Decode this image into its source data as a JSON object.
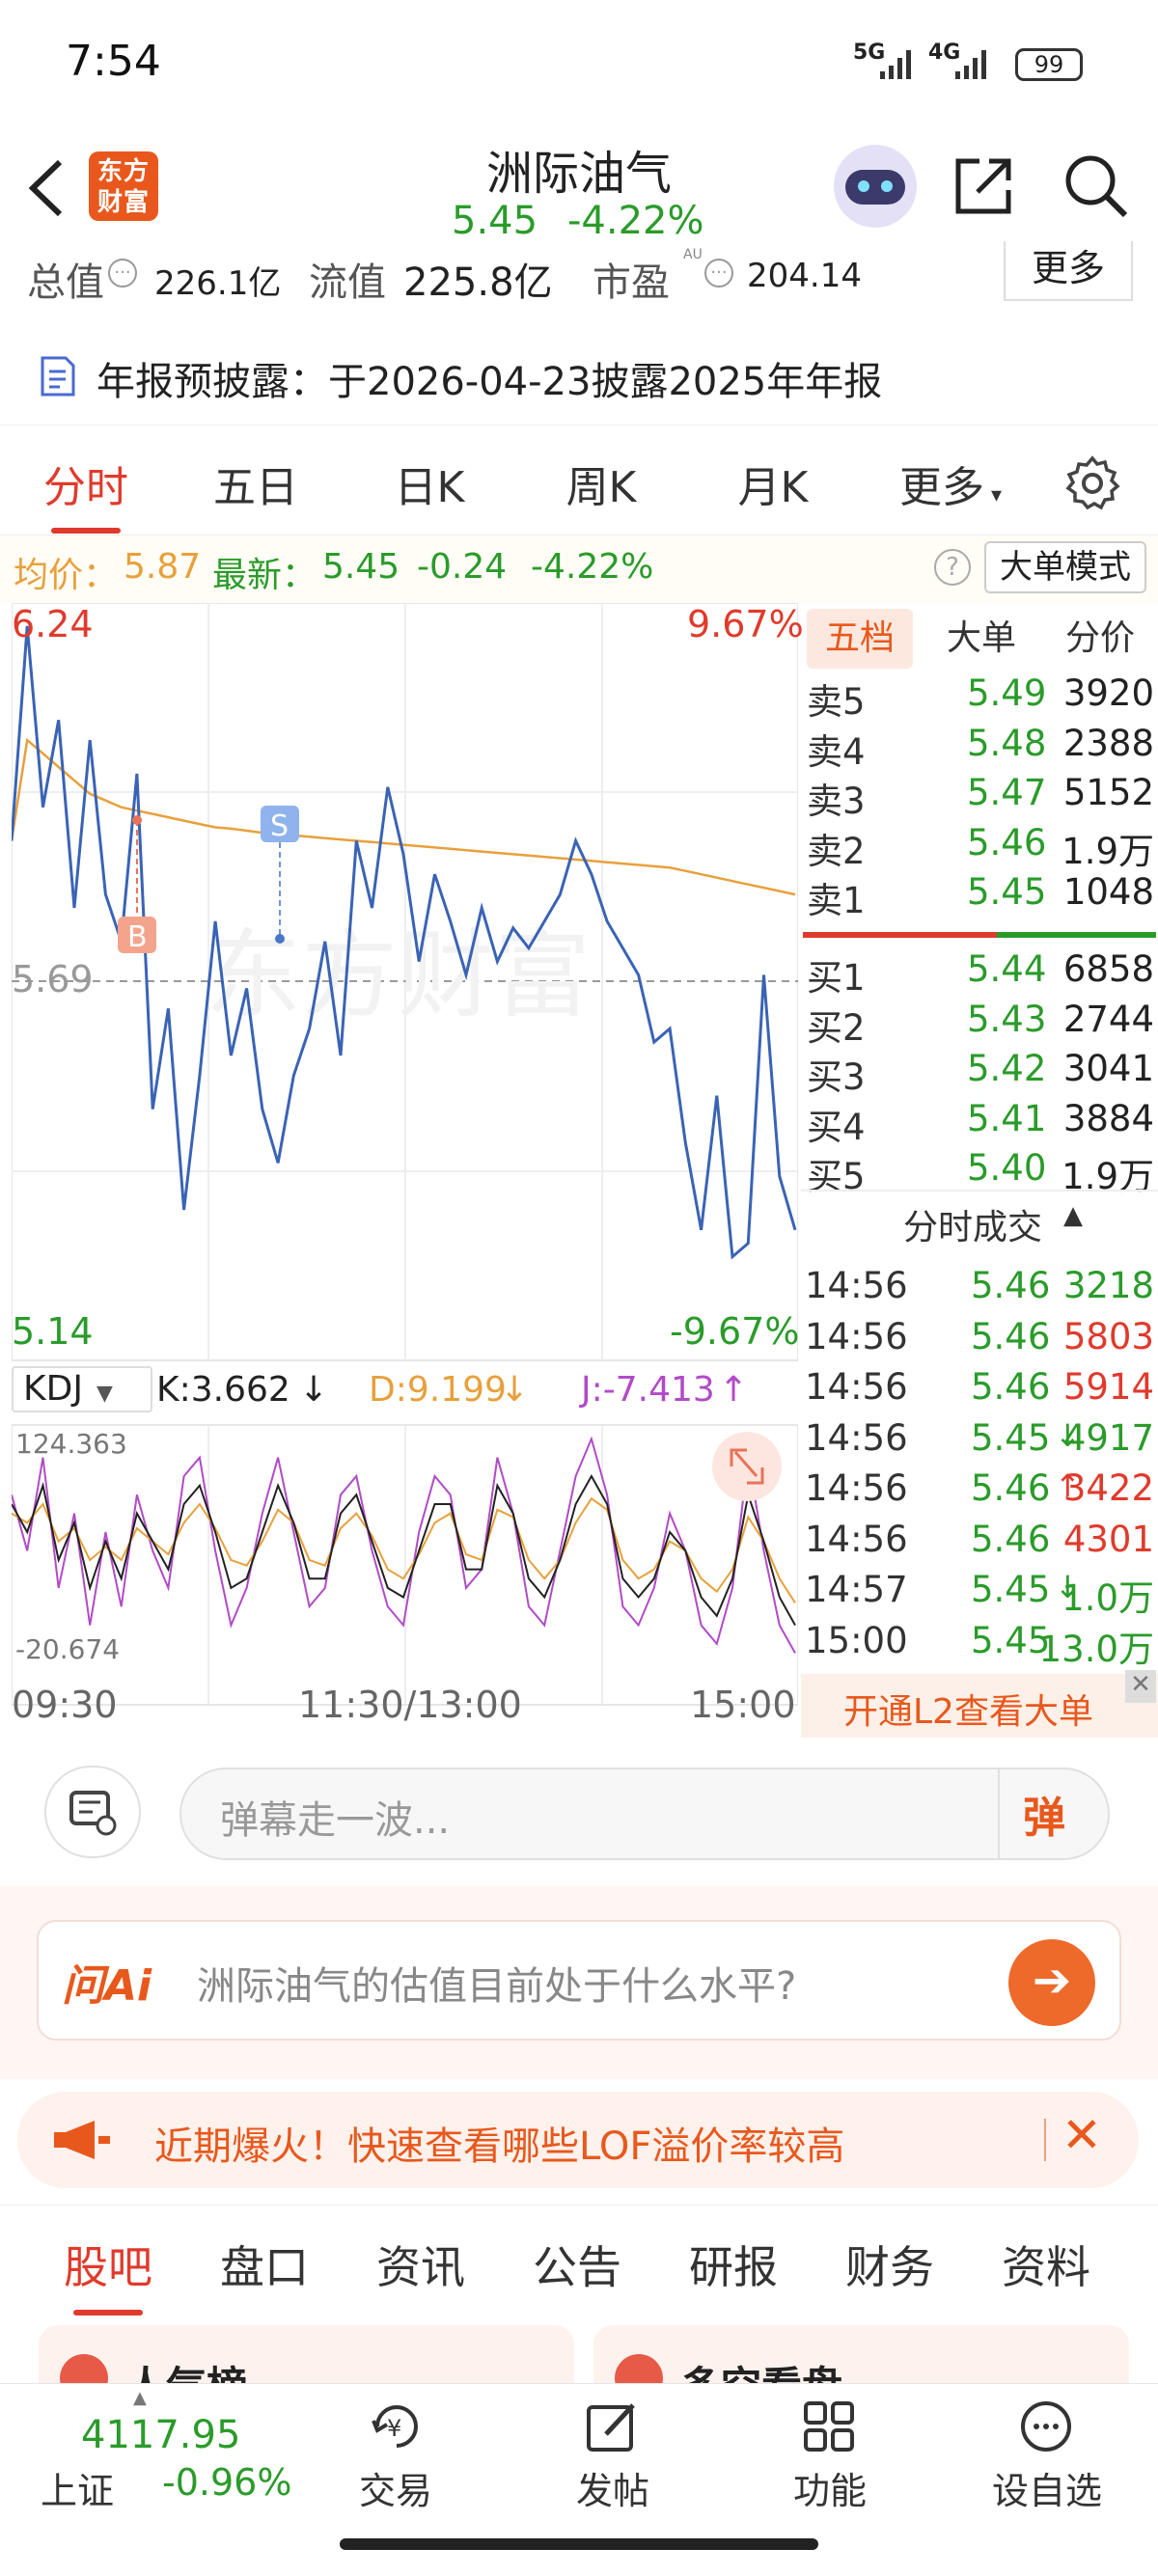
{
  "status_bar": {
    "time": "7:54",
    "network1": "5G",
    "network2": "4G",
    "battery": "99"
  },
  "header": {
    "logo_text": "东方财富",
    "stock_name": "洲际油气",
    "price": "5.45",
    "change_pct": "-4.22%"
  },
  "stats": {
    "total_value_label": "总值",
    "total_value": "226.1亿",
    "float_value_label": "流值",
    "float_value": "225.8亿",
    "pe_label": "市盈",
    "pe_sup": "AU",
    "pe_value": "204.14",
    "more_button": "更多"
  },
  "notice": {
    "text": "年报预披露：于2026-04-23披露2025年年报"
  },
  "tabs": [
    {
      "label": "分时"
    },
    {
      "label": "五日"
    },
    {
      "label": "日K"
    },
    {
      "label": "周K"
    },
    {
      "label": "月K"
    },
    {
      "label": "更多"
    }
  ],
  "info_bar": {
    "avg_label": "均价：",
    "avg_value": "5.87",
    "latest_label": "最新：",
    "latest_value": "5.45",
    "change": "-0.24",
    "change_pct": "-4.22%",
    "mode_button": "大单模式"
  },
  "price_chart": {
    "top_price": "6.24",
    "top_pct": "9.67%",
    "mid_price": "5.69",
    "bottom_price": "5.14",
    "bottom_pct": "-9.67%",
    "watermark": "东方财富",
    "marker_b": "B",
    "marker_s": "S"
  },
  "chart_data": [
    {
      "type": "line",
      "x_range": [
        "09:30",
        "15:00"
      ],
      "ylim": [
        5.14,
        6.24
      ],
      "reference": 5.69,
      "series": [
        {
          "values": [
            5.9,
            6.22,
            5.95,
            6.08,
            5.8,
            6.05,
            5.82,
            5.75,
            6.0,
            5.5,
            5.65,
            5.35,
            5.55,
            5.78,
            5.58,
            5.68,
            5.5,
            5.42,
            5.55,
            5.62,
            5.75,
            5.58,
            5.9,
            5.8,
            5.98,
            5.88,
            5.72,
            5.85,
            5.78,
            5.7,
            5.8,
            5.72,
            5.77,
            5.74,
            5.78,
            5.82,
            5.9,
            5.85,
            5.78,
            5.74,
            5.7,
            5.6,
            5.62,
            5.45,
            5.32,
            5.52,
            5.28,
            5.3,
            5.7,
            5.4,
            5.32
          ]
        },
        {
          "values": [
            5.9,
            6.05,
            6.03,
            6.01,
            5.99,
            5.97,
            5.96,
            5.95,
            5.945,
            5.94,
            5.935,
            5.93,
            5.925,
            5.92,
            5.918,
            5.915,
            5.912,
            5.91,
            5.908,
            5.906,
            5.904,
            5.902,
            5.9,
            5.898,
            5.896,
            5.894,
            5.892,
            5.89,
            5.888,
            5.886,
            5.884,
            5.882,
            5.88,
            5.878,
            5.876,
            5.874,
            5.872,
            5.87,
            5.868,
            5.866,
            5.864,
            5.862,
            5.86,
            5.855,
            5.85,
            5.845,
            5.84,
            5.835,
            5.83,
            5.825,
            5.82
          ]
        }
      ]
    },
    {
      "type": "line",
      "ylim": [
        -20.674,
        124.363
      ],
      "series": [
        {
          "values": [
            90,
            60,
            110,
            40,
            80,
            20,
            70,
            30,
            90,
            60,
            40,
            100,
            110,
            60,
            20,
            40,
            80,
            110,
            70,
            30,
            40,
            90,
            100,
            60,
            30,
            20,
            70,
            100,
            90,
            40,
            50,
            110,
            80,
            30,
            20,
            60,
            100,
            120,
            90,
            30,
            20,
            40,
            80,
            60,
            20,
            10,
            40,
            110,
            60,
            20,
            5
          ]
        },
        {
          "values": [
            85,
            70,
            95,
            55,
            75,
            40,
            65,
            45,
            80,
            65,
            50,
            85,
            95,
            70,
            40,
            45,
            70,
            95,
            75,
            45,
            45,
            80,
            90,
            65,
            40,
            35,
            60,
            85,
            85,
            50,
            50,
            95,
            80,
            45,
            35,
            55,
            85,
            100,
            85,
            45,
            35,
            45,
            70,
            60,
            35,
            25,
            45,
            90,
            65,
            35,
            20
          ]
        },
        {
          "values": [
            80,
            75,
            85,
            65,
            72,
            55,
            62,
            55,
            72,
            65,
            58,
            75,
            85,
            72,
            55,
            52,
            65,
            82,
            75,
            55,
            52,
            72,
            80,
            68,
            50,
            45,
            58,
            75,
            80,
            58,
            55,
            82,
            78,
            55,
            45,
            55,
            75,
            88,
            82,
            55,
            45,
            50,
            65,
            60,
            45,
            38,
            50,
            78,
            65,
            45,
            32
          ]
        }
      ]
    }
  ],
  "kdj": {
    "label": "KDJ",
    "k": "K:3.662",
    "d": "D:9.199",
    "j": "J:-7.413",
    "top": "124.363",
    "bottom": "-20.674"
  },
  "time_axis": {
    "start": "09:30",
    "mid": "11:30/13:00",
    "end": "15:00"
  },
  "order_book": {
    "tabs": [
      "五档",
      "大单",
      "分价"
    ],
    "sells": [
      {
        "label": "卖5",
        "price": "5.49",
        "vol": "3920"
      },
      {
        "label": "卖4",
        "price": "5.48",
        "vol": "2388"
      },
      {
        "label": "卖3",
        "price": "5.47",
        "vol": "5152"
      },
      {
        "label": "卖2",
        "price": "5.46",
        "vol": "1.9万"
      },
      {
        "label": "卖1",
        "price": "5.45",
        "vol": "1048"
      }
    ],
    "buys": [
      {
        "label": "买1",
        "price": "5.44",
        "vol": "6858"
      },
      {
        "label": "买2",
        "price": "5.43",
        "vol": "2744"
      },
      {
        "label": "买3",
        "price": "5.42",
        "vol": "3041"
      },
      {
        "label": "买4",
        "price": "5.41",
        "vol": "3884"
      },
      {
        "label": "买5",
        "price": "5.40",
        "vol": "1.9万"
      }
    ],
    "buy_ratio": 0.55
  },
  "trades": {
    "title": "分时成交",
    "rows": [
      {
        "time": "14:56",
        "price": "5.46",
        "vol": "3218",
        "color": "#2a9b2a",
        "arrow": ""
      },
      {
        "time": "14:56",
        "price": "5.46",
        "vol": "5803",
        "color": "#e03a2c",
        "arrow": ""
      },
      {
        "time": "14:56",
        "price": "5.46",
        "vol": "5914",
        "color": "#e03a2c",
        "arrow": ""
      },
      {
        "time": "14:56",
        "price": "5.45",
        "vol": "4917",
        "color": "#2a9b2a",
        "arrow": "↓"
      },
      {
        "time": "14:56",
        "price": "5.46",
        "vol": "3422",
        "color": "#e03a2c",
        "arrow": "↑"
      },
      {
        "time": "14:56",
        "price": "5.46",
        "vol": "4301",
        "color": "#e03a2c",
        "arrow": ""
      },
      {
        "time": "14:57",
        "price": "5.45",
        "vol": "1.0万",
        "color": "#2a9b2a",
        "arrow": "↓"
      },
      {
        "time": "15:00",
        "price": "5.45",
        "vol": "13.0万",
        "color": "#2a9b2a",
        "arrow": ""
      }
    ],
    "l2_banner": "开通L2查看大单"
  },
  "danmu": {
    "placeholder": "弹幕走一波..."
  },
  "ai": {
    "brand": "问Ai",
    "question": "洲际油气的估值目前处于什么水平?"
  },
  "promo": {
    "text": "近期爆火！快速查看哪些LOF溢价率较高"
  },
  "subtabs": [
    "股吧",
    "盘口",
    "资讯",
    "公告",
    "研报",
    "财务",
    "资料"
  ],
  "peek": {
    "left": "人气榜",
    "right": "多空看盘"
  },
  "bottom_nav": {
    "index_value": "4117.95",
    "index_name": "上证",
    "index_change": "-0.96%",
    "items": [
      {
        "label": "交易"
      },
      {
        "label": "发帖"
      },
      {
        "label": "功能"
      },
      {
        "label": "设自选"
      }
    ]
  }
}
